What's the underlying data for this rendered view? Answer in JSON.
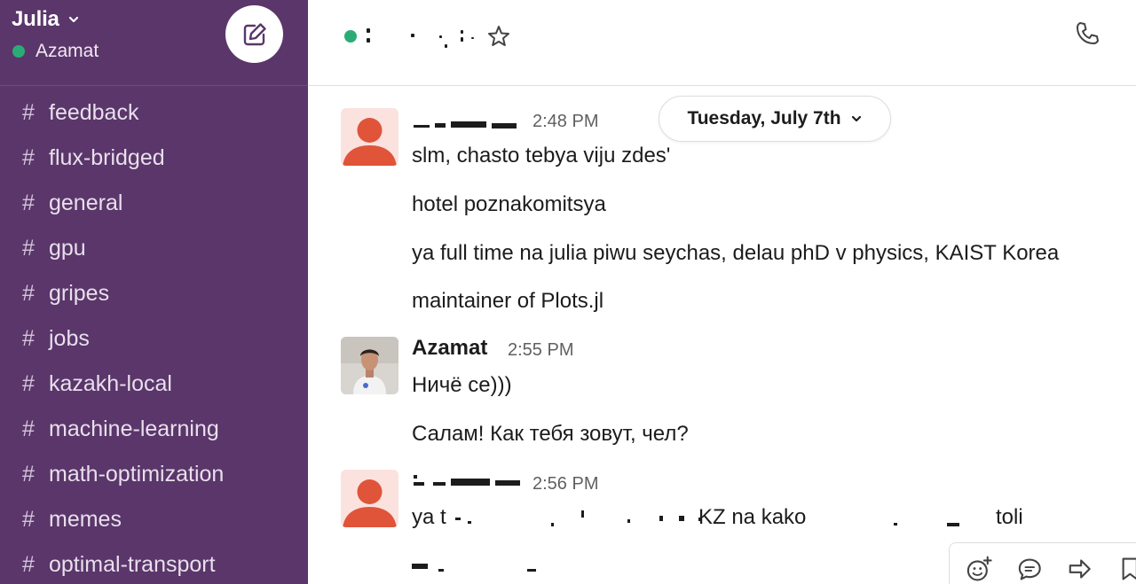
{
  "workspace": {
    "name": "Julia",
    "user": "Azamat"
  },
  "sidebar": {
    "channels": [
      {
        "label": "feedback"
      },
      {
        "label": "flux-bridged"
      },
      {
        "label": "general"
      },
      {
        "label": "gpu"
      },
      {
        "label": "gripes"
      },
      {
        "label": "jobs"
      },
      {
        "label": "kazakh-local"
      },
      {
        "label": "machine-learning"
      },
      {
        "label": "math-optimization"
      },
      {
        "label": "memes"
      },
      {
        "label": "optimal-transport"
      }
    ],
    "hash_symbol": "#"
  },
  "header": {
    "presence_color": "#2bac76"
  },
  "date_divider": {
    "label": "Tuesday, July 7th"
  },
  "messages": [
    {
      "time": "2:48 PM",
      "lines": [
        "slm, chasto tebya viju zdes'",
        "hotel poznakomitsya",
        "ya full time na julia piwu seychas, delau phD v physics, KAIST Korea",
        "maintainer of Plots.jl"
      ]
    },
    {
      "sender": "Azamat",
      "time": "2:55 PM",
      "lines": [
        "Ничё се)))",
        "Салам! Как тебя зовут, чел?"
      ]
    },
    {
      "time": "2:56 PM",
      "lines": [
        "ya t",
        "KZ na kako",
        "toli"
      ]
    }
  ],
  "colors": {
    "sidebar_bg": "#5a366a",
    "online": "#2bac76",
    "avatar_red": "#e0543a"
  },
  "icons": {
    "compose": "compose-icon",
    "star": "star-icon",
    "phone": "phone-icon",
    "chevron": "chevron-down-icon",
    "emoji": "add-reaction-icon",
    "thread": "thread-icon",
    "share": "share-icon",
    "bookmark": "bookmark-icon"
  }
}
